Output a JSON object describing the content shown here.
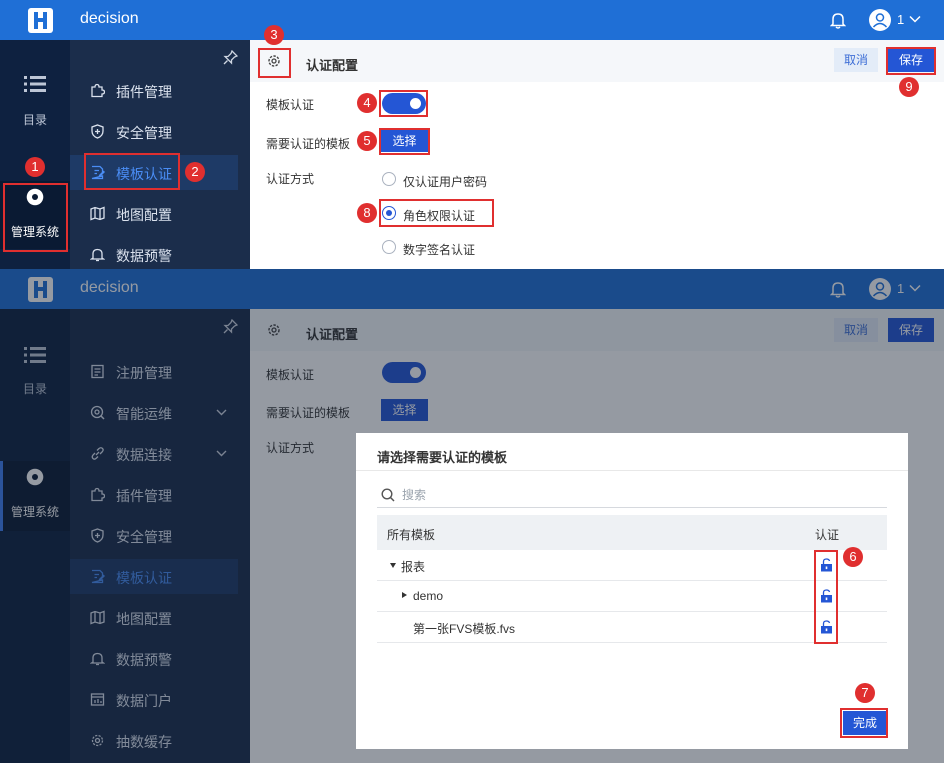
{
  "header": {
    "app_name": "decision",
    "user_id": "1"
  },
  "left_nav": {
    "catalog_label": "目录",
    "admin_label": "管理系统"
  },
  "panel1": {
    "menu": [
      {
        "label": "插件管理",
        "icon": "puzzle-icon"
      },
      {
        "label": "安全管理",
        "icon": "shield-icon"
      },
      {
        "label": "模板认证",
        "icon": "doc-edit-icon",
        "active": true
      },
      {
        "label": "地图配置",
        "icon": "map-icon"
      },
      {
        "label": "数据预警",
        "icon": "bell-icon"
      }
    ]
  },
  "panel2": {
    "menu": [
      {
        "label": "注册管理",
        "icon": "register-icon"
      },
      {
        "label": "智能运维",
        "icon": "ops-icon",
        "expandable": true
      },
      {
        "label": "数据连接",
        "icon": "link-icon",
        "expandable": true
      },
      {
        "label": "插件管理",
        "icon": "puzzle-icon"
      },
      {
        "label": "安全管理",
        "icon": "shield-icon"
      },
      {
        "label": "模板认证",
        "icon": "doc-edit-icon",
        "active": true
      },
      {
        "label": "地图配置",
        "icon": "map-icon"
      },
      {
        "label": "数据预警",
        "icon": "bell-icon"
      },
      {
        "label": "数据门户",
        "icon": "portal-icon"
      },
      {
        "label": "抽数缓存",
        "icon": "cache-icon"
      }
    ]
  },
  "config": {
    "title": "认证配置",
    "cancel_label": "取消",
    "save_label": "保存",
    "template_auth_label": "模板认证",
    "template_auth_enabled": true,
    "need_auth_label": "需要认证的模板",
    "select_label": "选择",
    "auth_method_label": "认证方式",
    "auth_methods": [
      "仅认证用户密码",
      "角色权限认证",
      "数字签名认证"
    ],
    "selected_method": 1
  },
  "dialog": {
    "title": "请选择需要认证的模板",
    "search_placeholder": "搜索",
    "col_all": "所有模板",
    "col_auth": "认证",
    "rows": [
      {
        "label": "报表",
        "expanded": true
      },
      {
        "label": "demo",
        "expanded": false
      },
      {
        "label": "第一张FVS模板.fvs"
      }
    ],
    "done_label": "完成"
  },
  "markers": [
    "1",
    "2",
    "3",
    "4",
    "5",
    "6",
    "7",
    "8",
    "9"
  ],
  "colors": {
    "header_blue": "#1f6fd6",
    "primary": "#2456d5",
    "annotation_red": "#e02f2f",
    "sidebar_dark": "#0e2140"
  }
}
